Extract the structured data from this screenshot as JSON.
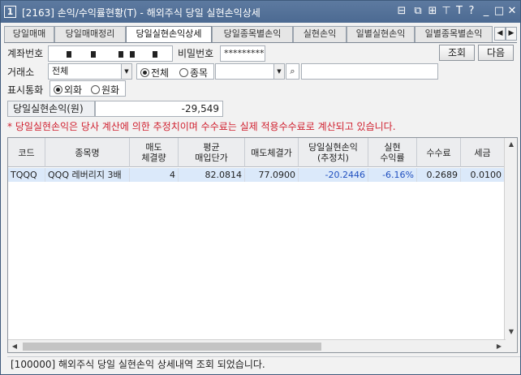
{
  "window": {
    "title": "[2163] 손익/수익률현황(T) - 해외주식 당일 실현손익상세",
    "app_icon": "1",
    "title_icons": [
      "dock-icon",
      "restore-icon",
      "link-icon",
      "pin-icon",
      "text-icon",
      "help-icon",
      "minimize-icon",
      "maximize-icon",
      "close-icon"
    ],
    "title_glyphs": [
      "⊟",
      "⧉",
      "⊞",
      "⊤",
      "T",
      "?",
      "_",
      "□",
      "✕"
    ]
  },
  "tabs": [
    {
      "label": "당일매매",
      "active": false
    },
    {
      "label": "당일매매정리",
      "active": false
    },
    {
      "label": "당일실현손익상세",
      "active": true
    },
    {
      "label": "당일종목별손익",
      "active": false
    },
    {
      "label": "실현손익",
      "active": false
    },
    {
      "label": "일별실현손익",
      "active": false
    },
    {
      "label": "일별종목별손익",
      "active": false
    }
  ],
  "tab_arrows": {
    "left": "◀",
    "right": "▶"
  },
  "form": {
    "account_label": "계좌번호",
    "password_label": "비밀번호",
    "password_value": "*********",
    "query_button": "조회",
    "next_button": "다음",
    "exchange_label": "거래소",
    "exchange_value": "전체",
    "radio_all": "전체",
    "radio_item": "종목",
    "radio_all_selected": true,
    "currency_label": "표시통화",
    "radio_foreign": "외화",
    "radio_won": "원화",
    "radio_foreign_selected": true
  },
  "summary": {
    "label": "당일실현손익(원)",
    "value": "-29,549"
  },
  "note": "* 당일실현손익은 당사 계산에 의한 추정치이며 수수료는 실제 적용수수료로 계산되고 있습니다.",
  "table": {
    "headers": [
      "코드",
      "종목명",
      "매도\n체결량",
      "평균\n매입단가",
      "매도체결가",
      "당일실현손익\n(추정치)",
      "실현\n수익률",
      "수수료",
      "세금"
    ],
    "rows": [
      {
        "code": "TQQQ",
        "name": "QQQ 레버리지 3배",
        "qty": "4",
        "avg_price": "82.0814",
        "sell_price": "77.0900",
        "pnl": "-20.2446",
        "rate": "-6.16%",
        "fee": "0.2689",
        "tax": "0.0100"
      }
    ]
  },
  "scroll": {
    "up": "▲",
    "down": "▼",
    "left": "◀",
    "right": "▶"
  },
  "status": "[100000] 해외주식 당일 실현손익 상세내역 조회 되었습니다.",
  "colors": {
    "titlebar": "#4f6d95",
    "selected_row": "#dbe9fa",
    "note": "#d0202f",
    "negative": "#1f4fbf"
  }
}
